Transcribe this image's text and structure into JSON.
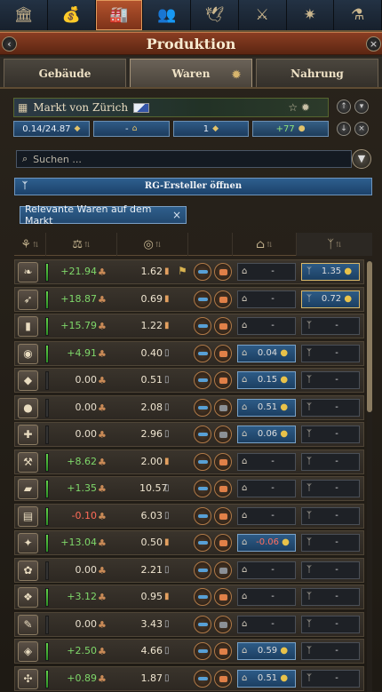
{
  "topbar": {
    "icons": [
      "government-icon",
      "economy-icon",
      "production-icon",
      "population-icon",
      "diplomacy-icon",
      "military-icon",
      "technology-icon",
      "flask-icon"
    ],
    "active_index": 2
  },
  "title": "Produktion",
  "tabs": [
    {
      "label": "Gebäude"
    },
    {
      "label": "Waren"
    },
    {
      "label": "Nahrung"
    }
  ],
  "active_tab": 1,
  "market": {
    "name": "Markt von Zürich",
    "stats": [
      {
        "value": "0.14/24.87"
      },
      {
        "value": "-"
      },
      {
        "value": "1"
      },
      {
        "value": "+77"
      }
    ]
  },
  "search": {
    "placeholder": "Suchen ..."
  },
  "rg_button": "RG-Ersteller öffnen",
  "filter_chip": "Relevante Waren auf dem Markt",
  "rows": [
    {
      "icon": "grain-icon",
      "glyph": "❧",
      "balance": "+21.94",
      "sign": "pos",
      "price": "1.62",
      "trend": "up",
      "flag": true,
      "btn2": "orange",
      "export": "-",
      "export_hi": false,
      "rg": "1.35",
      "rg_hi": true
    },
    {
      "icon": "fish-icon",
      "glyph": "➶",
      "balance": "+18.87",
      "sign": "pos",
      "price": "0.69",
      "trend": "up",
      "flag": false,
      "btn2": "orange",
      "export": "-",
      "export_hi": false,
      "rg": "0.72",
      "rg_hi": true
    },
    {
      "icon": "wood-icon",
      "glyph": "▮",
      "balance": "+15.79",
      "sign": "pos",
      "price": "1.22",
      "trend": "up",
      "flag": false,
      "btn2": "orange",
      "export": "-",
      "export_hi": false,
      "rg": "-",
      "rg_hi": false
    },
    {
      "icon": "meat-icon",
      "glyph": "◉",
      "balance": "+4.91",
      "sign": "pos",
      "price": "0.40",
      "trend": "dn",
      "flag": false,
      "btn2": "orange",
      "export": "0.04",
      "export_hi": true,
      "rg": "-",
      "rg_hi": false
    },
    {
      "icon": "stone-icon",
      "glyph": "◆",
      "balance": "0.00",
      "sign": "zero",
      "price": "0.51",
      "trend": "dn",
      "flag": false,
      "btn2": "orange",
      "export": "0.15",
      "export_hi": true,
      "rg": "-",
      "rg_hi": false
    },
    {
      "icon": "coal-icon",
      "glyph": "●",
      "balance": "0.00",
      "sign": "zero",
      "price": "2.08",
      "trend": "dn",
      "flag": false,
      "btn2": "grey",
      "export": "0.51",
      "export_hi": true,
      "rg": "-",
      "rg_hi": false
    },
    {
      "icon": "iron-icon",
      "glyph": "✚",
      "balance": "0.00",
      "sign": "zero",
      "price": "2.96",
      "trend": "dn",
      "flag": false,
      "btn2": "grey",
      "export": "0.06",
      "export_hi": true,
      "rg": "-",
      "rg_hi": false
    },
    {
      "icon": "tools-icon",
      "glyph": "⚒",
      "balance": "+8.62",
      "sign": "pos",
      "price": "2.00",
      "trend": "up",
      "flag": false,
      "btn2": "orange",
      "export": "-",
      "export_hi": false,
      "rg": "-",
      "rg_hi": false
    },
    {
      "icon": "gold-icon",
      "glyph": "▰",
      "balance": "+1.35",
      "sign": "pos",
      "price": "10.57",
      "trend": "dn",
      "flag": false,
      "btn2": "orange",
      "export": "-",
      "export_hi": false,
      "rg": "-",
      "rg_hi": false
    },
    {
      "icon": "glass-icon",
      "glyph": "▤",
      "balance": "-0.10",
      "sign": "neg",
      "price": "6.03",
      "trend": "dn",
      "flag": false,
      "btn2": "orange",
      "export": "-",
      "export_hi": false,
      "rg": "-",
      "rg_hi": false
    },
    {
      "icon": "sulfur-icon",
      "glyph": "✦",
      "balance": "+13.04",
      "sign": "pos",
      "price": "0.50",
      "trend": "up",
      "flag": false,
      "btn2": "orange",
      "export": "-0.06",
      "export_hi": true,
      "rg": "-",
      "rg_hi": false
    },
    {
      "icon": "fruit-icon",
      "glyph": "✿",
      "balance": "0.00",
      "sign": "zero",
      "price": "2.21",
      "trend": "dn",
      "flag": false,
      "btn2": "grey",
      "export": "-",
      "export_hi": false,
      "rg": "-",
      "rg_hi": false
    },
    {
      "icon": "fabric-icon",
      "glyph": "❖",
      "balance": "+3.12",
      "sign": "pos",
      "price": "0.95",
      "trend": "up",
      "flag": false,
      "btn2": "orange",
      "export": "-",
      "export_hi": false,
      "rg": "-",
      "rg_hi": false
    },
    {
      "icon": "paper-icon",
      "glyph": "✎",
      "balance": "0.00",
      "sign": "zero",
      "price": "3.43",
      "trend": "dn",
      "flag": false,
      "btn2": "grey",
      "export": "-",
      "export_hi": false,
      "rg": "-",
      "rg_hi": false
    },
    {
      "icon": "dye-icon",
      "glyph": "◈",
      "balance": "+2.50",
      "sign": "pos",
      "price": "4.66",
      "trend": "dn",
      "flag": false,
      "btn2": "orange",
      "export": "0.59",
      "export_hi": true,
      "rg": "-",
      "rg_hi": false
    },
    {
      "icon": "silk-icon",
      "glyph": "✣",
      "balance": "+0.89",
      "sign": "pos",
      "price": "1.87",
      "trend": "dn",
      "flag": false,
      "btn2": "orange",
      "export": "0.51",
      "export_hi": true,
      "rg": "-",
      "rg_hi": false
    }
  ],
  "colors": {
    "accent_active": "#b4542e",
    "positive": "#7fd86a",
    "negative": "#ff6b58",
    "blue": "#2d5b86"
  }
}
